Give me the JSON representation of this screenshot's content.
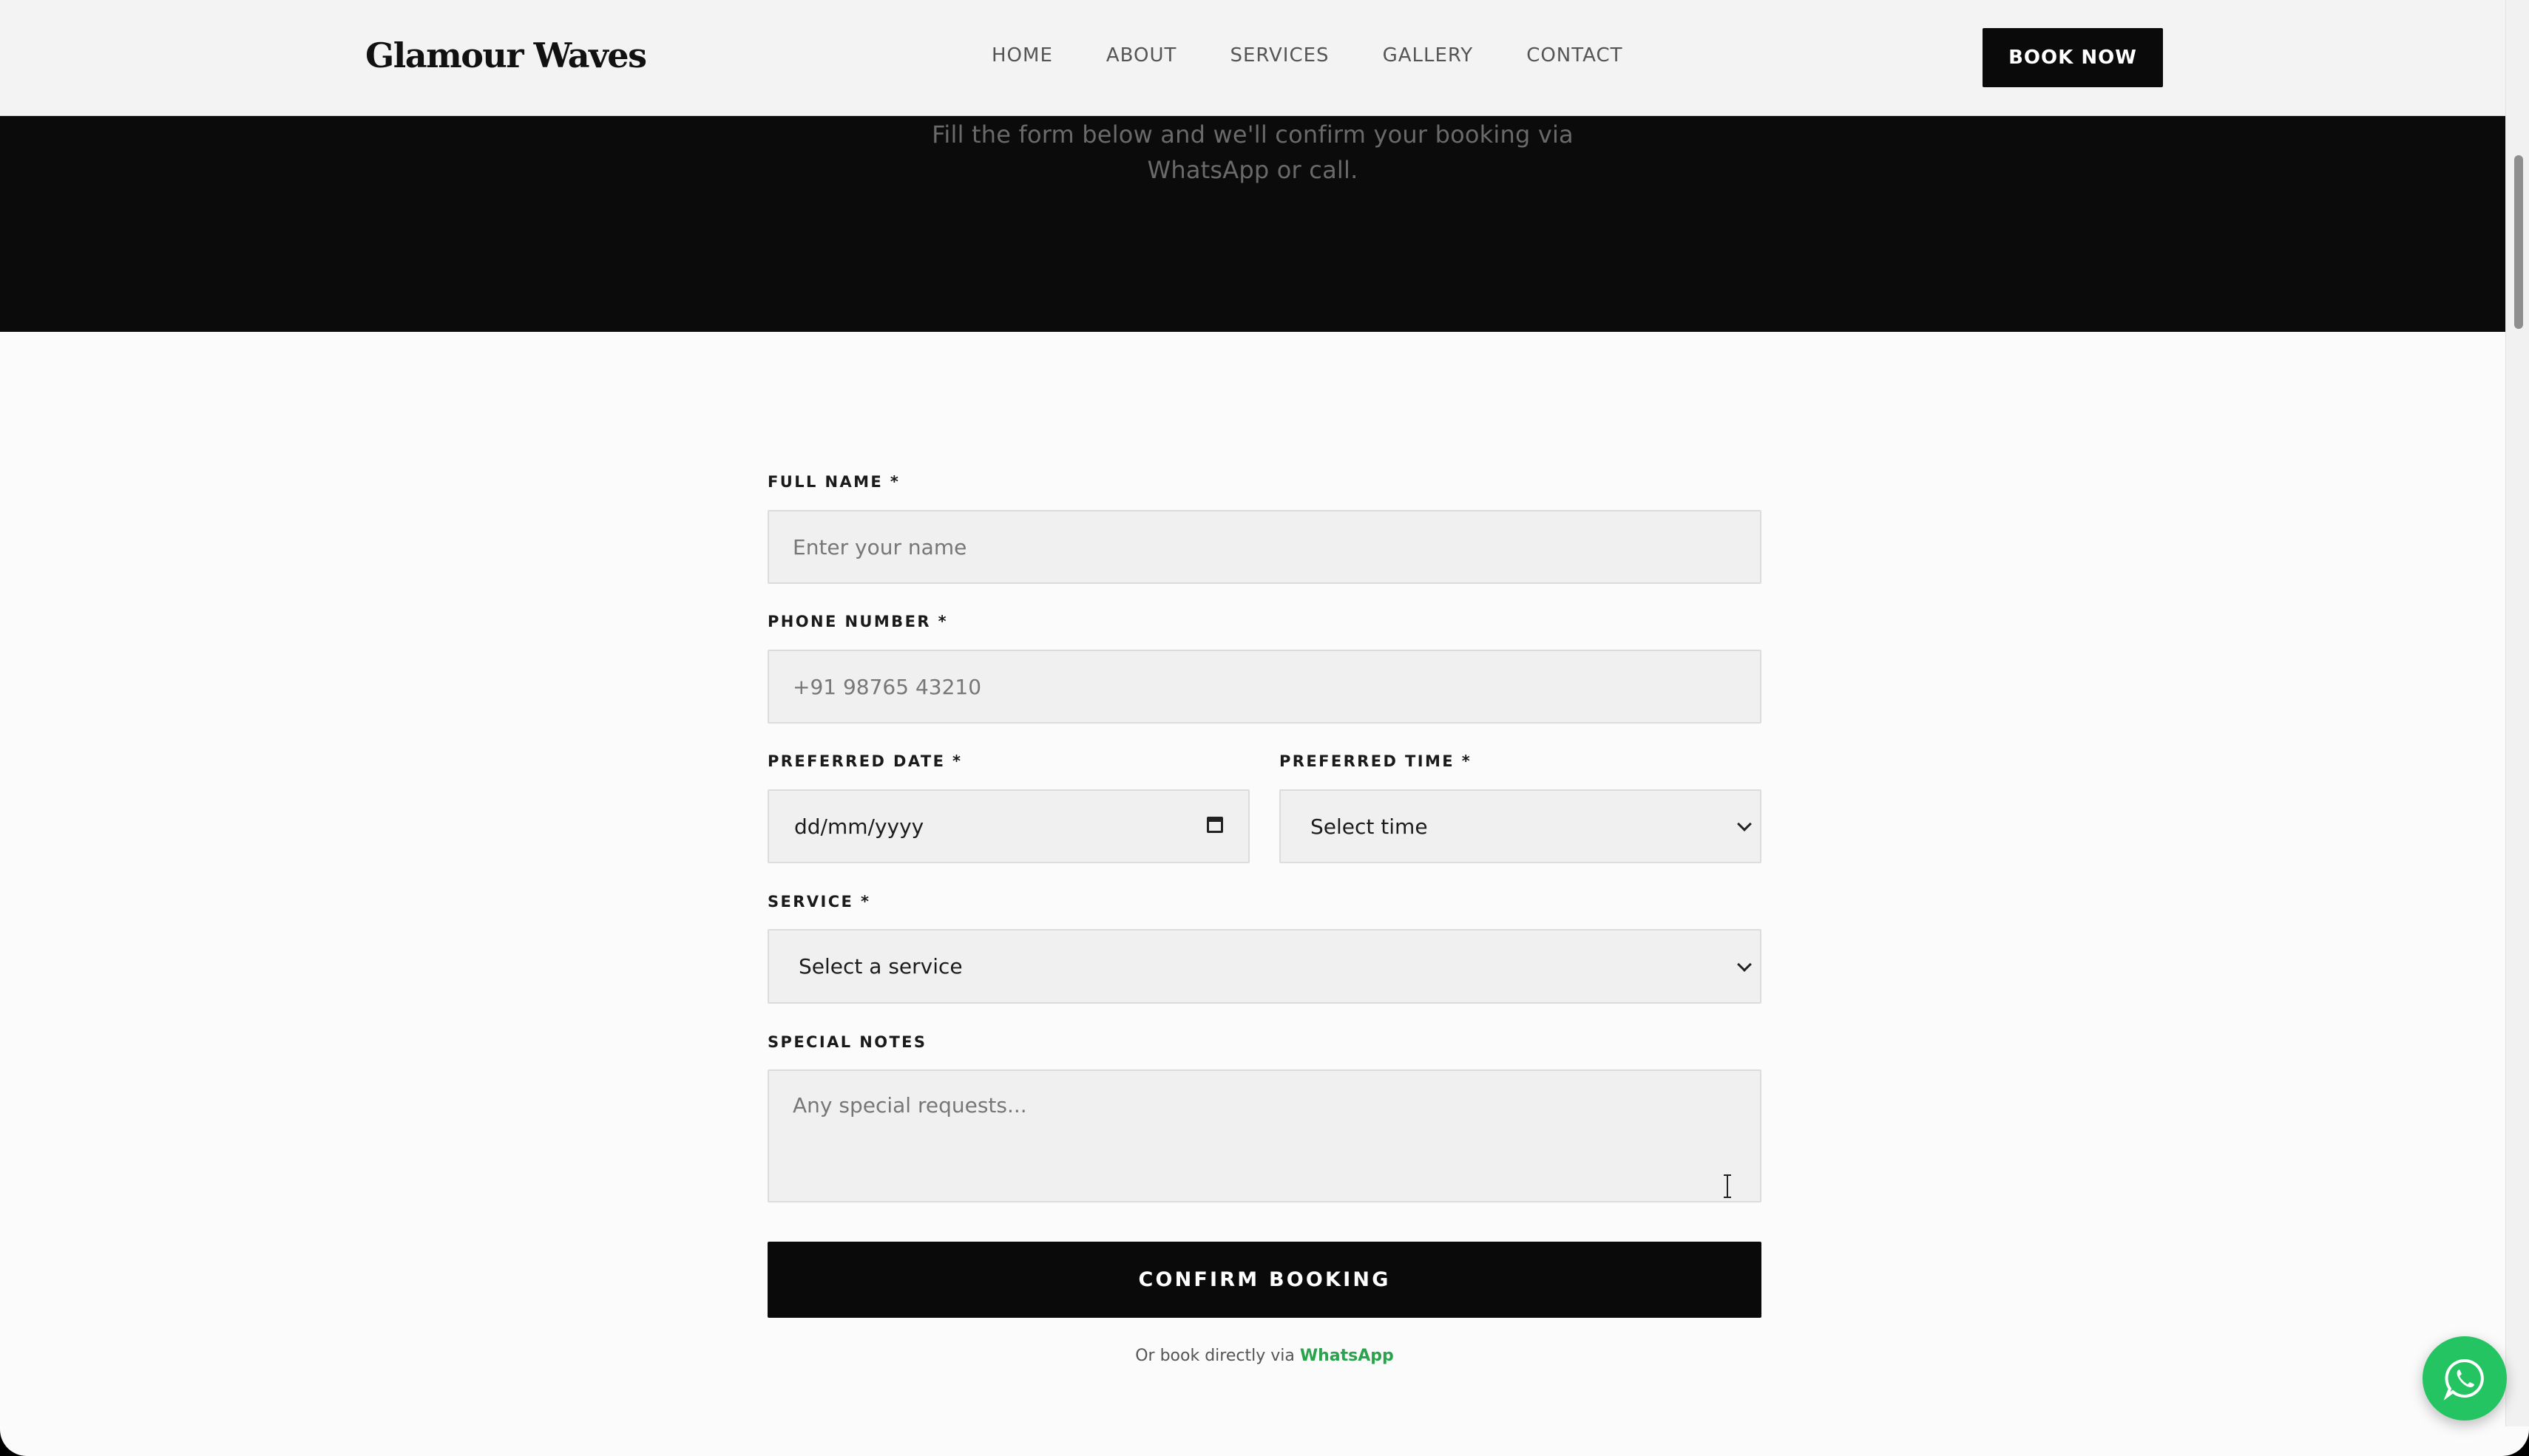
{
  "brand": {
    "name": "Glamour Waves"
  },
  "nav": {
    "items": [
      {
        "label": "HOME"
      },
      {
        "label": "ABOUT"
      },
      {
        "label": "SERVICES"
      },
      {
        "label": "GALLERY"
      },
      {
        "label": "CONTACT"
      }
    ],
    "cta_label": "BOOK NOW"
  },
  "hero": {
    "subtitle_line1": "Fill the form below and we'll confirm your booking via",
    "subtitle_line2": "WhatsApp or call."
  },
  "form": {
    "full_name": {
      "label": "FULL NAME *",
      "placeholder": "Enter your name",
      "value": ""
    },
    "phone": {
      "label": "PHONE NUMBER *",
      "placeholder": "+91 98765 43210",
      "value": ""
    },
    "date": {
      "label": "PREFERRED DATE *",
      "value": "dd/mm/yyyy"
    },
    "time": {
      "label": "PREFERRED TIME *",
      "selected": "Select time"
    },
    "service": {
      "label": "SERVICE *",
      "selected": "Select a service"
    },
    "notes": {
      "label": "SPECIAL NOTES",
      "placeholder": "Any special requests...",
      "value": ""
    },
    "submit_label": "CONFIRM BOOKING",
    "alt_prefix": "Or book directly via ",
    "alt_link": "WhatsApp"
  },
  "colors": {
    "accent_dark": "#0a0a0a",
    "whatsapp_green": "#25c462",
    "link_green": "#29a44c"
  },
  "icons": {
    "calendar": "calendar-icon",
    "chevron": "chevron-down-icon",
    "whatsapp": "whatsapp-icon",
    "cursor": "text-cursor-icon"
  }
}
